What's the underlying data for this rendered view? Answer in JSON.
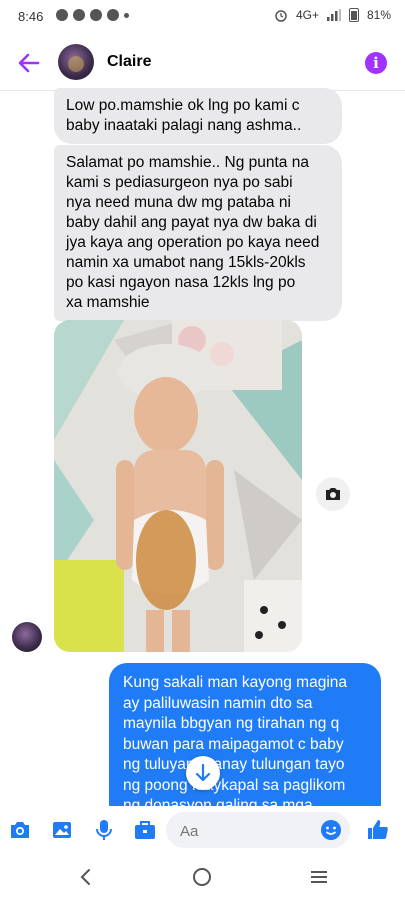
{
  "status_bar": {
    "time": "8:46",
    "network": "4G+",
    "battery": "81%"
  },
  "header": {
    "contact_name": "Claire",
    "info_glyph": "i",
    "accent_color": "#a033ff"
  },
  "messages": [
    {
      "direction": "incoming",
      "text": "Low po.mamshie ok lng po kami c\nbaby inaataki palagi nang ashma.."
    },
    {
      "direction": "incoming",
      "text": "Salamat po mamshie.. Ng punta na\nkami s pediasurgeon nya po sabi\nnya need muna dw mg pataba ni\nbaby dahil ang payat nya dw baka di\njya kaya ang operation po kaya need\nnamin xa umabot nang 15kls-20kls\npo kasi ngayon nasa 12kls lng po\nxa mamshie"
    },
    {
      "direction": "outgoing",
      "text": "Kung sakali man kayong magina\nay paliluwasin namin dto sa\nmaynila bbgyan ng tirahan ng q\nbuwan para maipagamot c baby\nng tuluyan. Sanay tulungan tayo\nng poong maykapal sa paglikom\nng donasyon galing sa mga",
      "color": "#1f7cf6"
    }
  ],
  "composer": {
    "placeholder": "Aa",
    "like_color": "#1f7cf6"
  },
  "icons": {
    "back": "arrow-left-icon",
    "camera": "camera-icon",
    "gallery": "image-icon",
    "mic": "microphone-icon",
    "games": "briefcase-icon",
    "emoji": "smiley-icon",
    "like": "thumbs-up-icon",
    "scroll_down": "arrow-down-icon"
  }
}
